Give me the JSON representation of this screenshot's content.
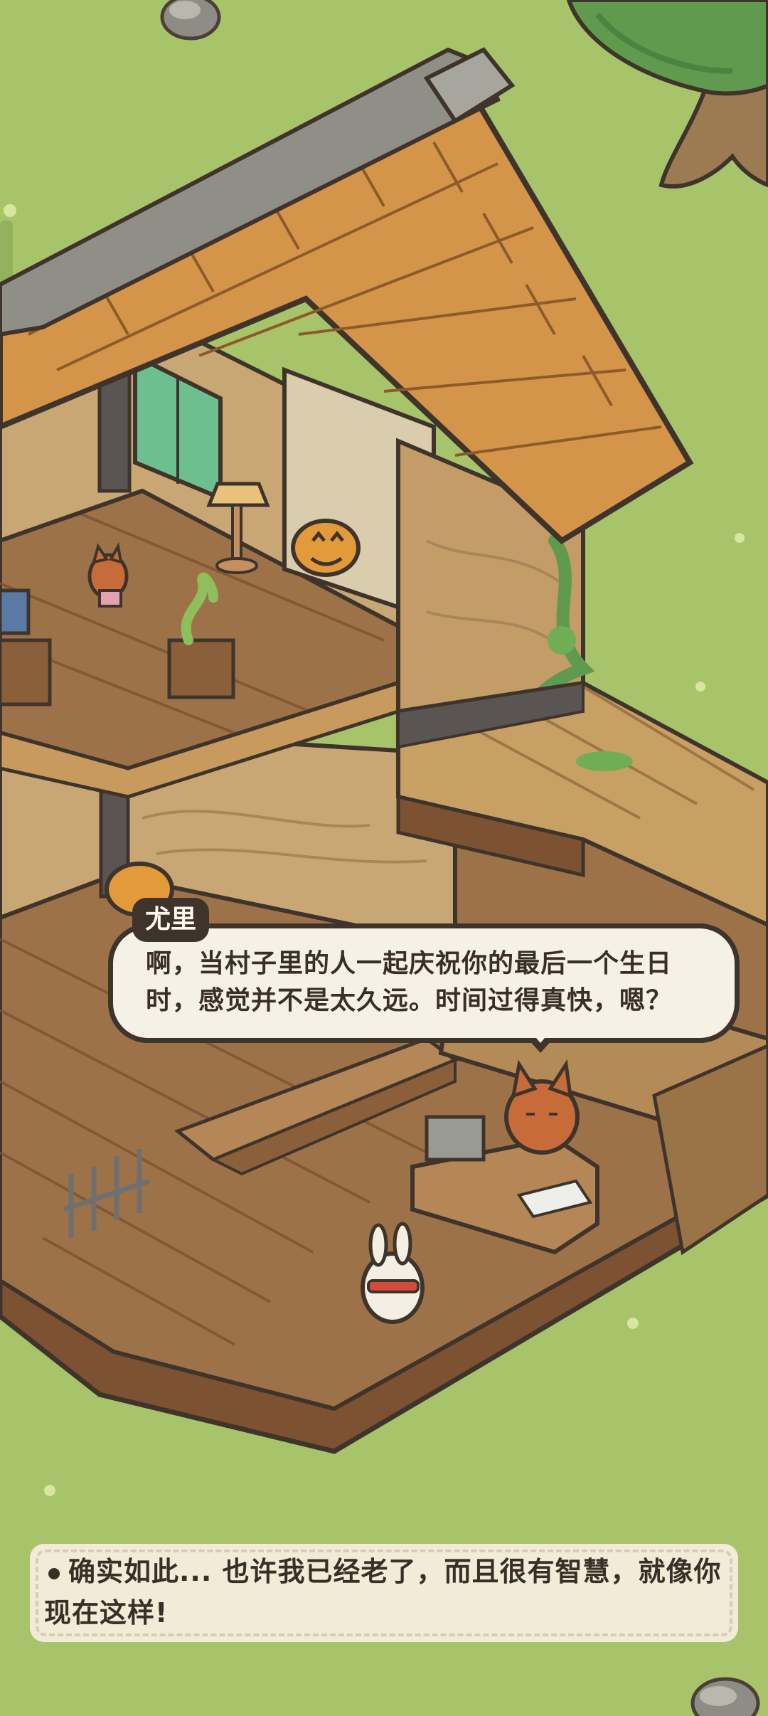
{
  "dialogue": {
    "speaker": "尤里",
    "text": "啊，当村子里的人一起庆祝你的最后一个生日时，感觉并不是太久远。时间过得真快，嗯？"
  },
  "choice": {
    "text": "确实如此... 也许我已经老了，而且很有智慧，就像你现在这样!"
  },
  "colors": {
    "grass": "#a8c46a",
    "roof": "#d4954a",
    "wall": "#c9a775",
    "floor": "#9e7249",
    "bubble": "#f5f1e4",
    "outline": "#3f342b"
  }
}
